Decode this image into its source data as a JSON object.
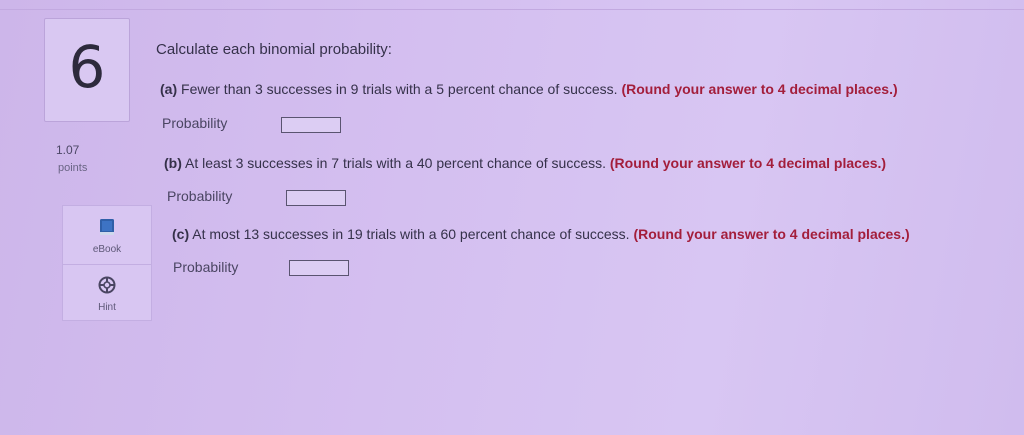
{
  "question": {
    "number": "6",
    "points_value": "1.07",
    "points_label": "points",
    "prompt": "Calculate each binomial probability:"
  },
  "tools": {
    "ebook_label": "eBook",
    "hint_label": "Hint"
  },
  "parts": [
    {
      "letter": "(a)",
      "text": "Fewer than 3 successes in 9 trials with a 5 percent chance of success.",
      "rounding": "(Round your answer to 4 decimal places.)",
      "answer_label": "Probability",
      "answer_value": ""
    },
    {
      "letter": "(b)",
      "text": "At least 3 successes in 7 trials with a 40 percent chance of success.",
      "rounding": "(Round your answer to 4 decimal places.)",
      "answer_label": "Probability",
      "answer_value": ""
    },
    {
      "letter": "(c)",
      "text": "At most 13 successes in 19 trials with a 60 percent chance of success.",
      "rounding": "(Round your answer to 4 decimal places.)",
      "answer_label": "Probability",
      "answer_value": ""
    }
  ],
  "colors": {
    "rounding_note": "#a31e3b",
    "ebook_icon": "#2f5fa8",
    "hint_icon": "#4a4562"
  },
  "icons": {
    "ebook": "book-icon",
    "hint": "lifebuoy-icon"
  }
}
